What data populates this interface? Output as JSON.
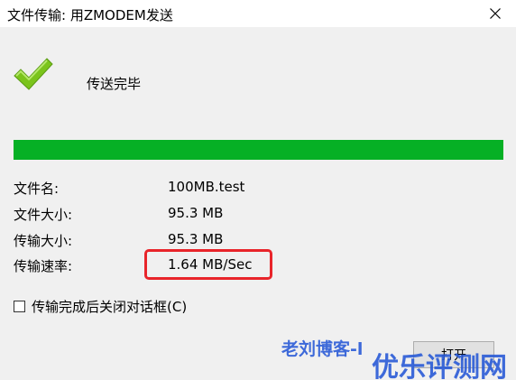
{
  "window": {
    "title": "文件传输: 用ZMODEM发送",
    "close_icon": "close-icon"
  },
  "status": {
    "icon": "checkmark-icon",
    "text": "传送完毕"
  },
  "progress": {
    "percent": 100,
    "fill_color": "#06b025"
  },
  "info": {
    "file_name_label": "文件名:",
    "file_name_value": "100MB.test",
    "file_size_label": "文件大小:",
    "file_size_value": "95.3 MB",
    "transfer_size_label": "传输大小:",
    "transfer_size_value": "95.3 MB",
    "transfer_rate_label": "传输速率:",
    "transfer_rate_value": "1.64 MB/Sec",
    "highlight_color": "#e8242a"
  },
  "options": {
    "close_after_label": "传输完成后关闭对话框(C)"
  },
  "buttons": {
    "open_label": "打开"
  },
  "watermark": {
    "line1": "老刘博客-l",
    "line2": "优乐评测网"
  }
}
